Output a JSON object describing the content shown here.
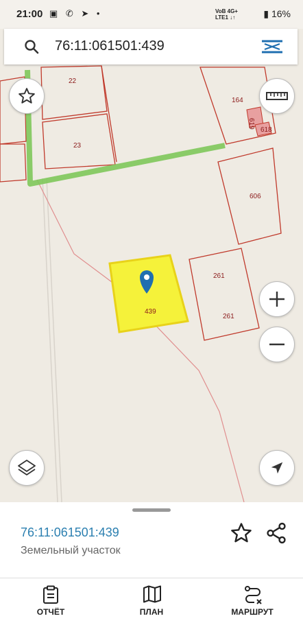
{
  "status_bar": {
    "time": "21:00",
    "battery": "16%",
    "network_top": "VoB 4G+",
    "network_bottom": "LTE1 ↓↑"
  },
  "search": {
    "query": "76:11:061501:439"
  },
  "map": {
    "plot_labels": {
      "p22": "22",
      "p23": "23",
      "p164": "164",
      "p619": "619",
      "p618": "618",
      "p606": "606",
      "p261a": "261",
      "p261b": "261",
      "p439": "439"
    },
    "colors": {
      "plot_border": "#c0392b",
      "selected_fill": "#f5f23a",
      "selected_border": "#e8d21a",
      "road_green": "#7ec85a",
      "marker": "#1f6fb0"
    }
  },
  "controls": {
    "favorite_icon": "star-icon",
    "ruler_icon": "ruler-icon",
    "zoom_in_icon": "plus-icon",
    "zoom_out_icon": "minus-icon",
    "layers_icon": "layers-icon",
    "locate_icon": "navigation-arrow-icon"
  },
  "sheet": {
    "cadastral_number": "76:11:061501:439",
    "object_type": "Земельный участок"
  },
  "nav": {
    "report": "ОТЧЁТ",
    "plan": "ПЛАН",
    "route": "МАРШРУТ"
  }
}
